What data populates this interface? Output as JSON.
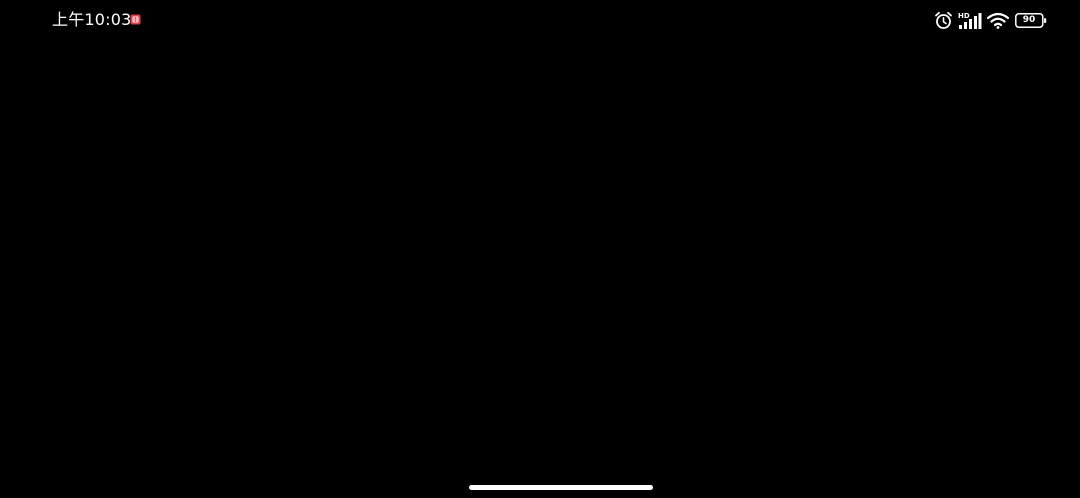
{
  "status_bar": {
    "time": "上午10:03",
    "network_type": "HD",
    "battery_level": "90",
    "icons": [
      "notification-app-icon",
      "alarm-icon",
      "hd-signal-icon",
      "wifi-icon",
      "battery-icon"
    ]
  },
  "colors": {
    "background": "#000000",
    "foreground": "#ffffff",
    "notification_accent": "#e0404a"
  }
}
